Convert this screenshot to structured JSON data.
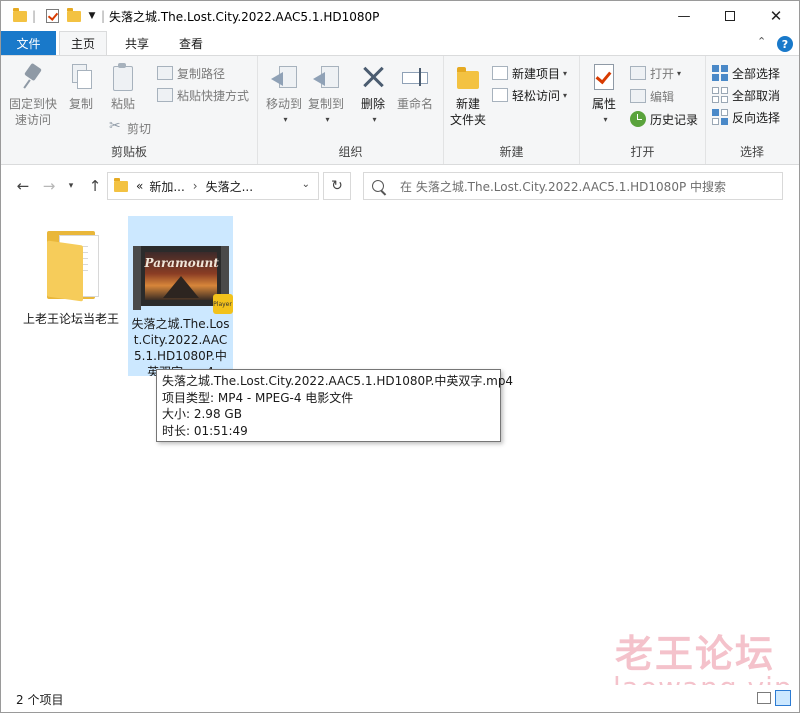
{
  "titlebar": {
    "title": "失落之城.The.Lost.City.2022.AAC5.1.HD1080P",
    "minimize_icon": "minimize-icon",
    "maximize_icon": "maximize-icon",
    "close_icon": "close-icon"
  },
  "tabs": {
    "file": "文件",
    "home": "主页",
    "share": "共享",
    "view": "查看"
  },
  "ribbon": {
    "clipboard": {
      "label": "剪贴板",
      "pin": "固定到快\n速访问",
      "copy": "复制",
      "paste": "粘贴",
      "copy_path": "复制路径",
      "paste_shortcut": "粘贴快捷方式",
      "cut": "剪切"
    },
    "organize": {
      "label": "组织",
      "move_to": "移动到",
      "copy_to": "复制到",
      "delete": "删除",
      "rename": "重命名"
    },
    "new": {
      "label": "新建",
      "new_folder": "新建\n文件夹",
      "new_item": "新建项目",
      "easy_access": "轻松访问"
    },
    "open": {
      "label": "打开",
      "properties": "属性",
      "open": "打开",
      "edit": "编辑",
      "history": "历史记录"
    },
    "select": {
      "label": "选择",
      "select_all": "全部选择",
      "select_none": "全部取消",
      "invert": "反向选择"
    }
  },
  "address": {
    "crumb_prefix": "«",
    "crumb1": "新加...",
    "crumb2": "失落之...",
    "search_placeholder": "在 失落之城.The.Lost.City.2022.AAC5.1.HD1080P 中搜索"
  },
  "items": [
    {
      "name": "上老王论坛当老王",
      "type": "folder"
    },
    {
      "name": "失落之城.The.Lost.City.2022.AAC5.1.HD1080P.中英双字.mp4",
      "type": "video",
      "thumb_text": "Paramount",
      "badge": "Player"
    }
  ],
  "tooltip": {
    "name": "失落之城.The.Lost.City.2022.AAC5.1.HD1080P.中英双字.mp4",
    "type": "项目类型: MP4 - MPEG-4 电影文件",
    "size": "大小: 2.98 GB",
    "duration": "时长: 01:51:49"
  },
  "watermark": {
    "line1": "老王论坛",
    "line2": "laowang.vip"
  },
  "status": {
    "count": "2 个项目"
  }
}
